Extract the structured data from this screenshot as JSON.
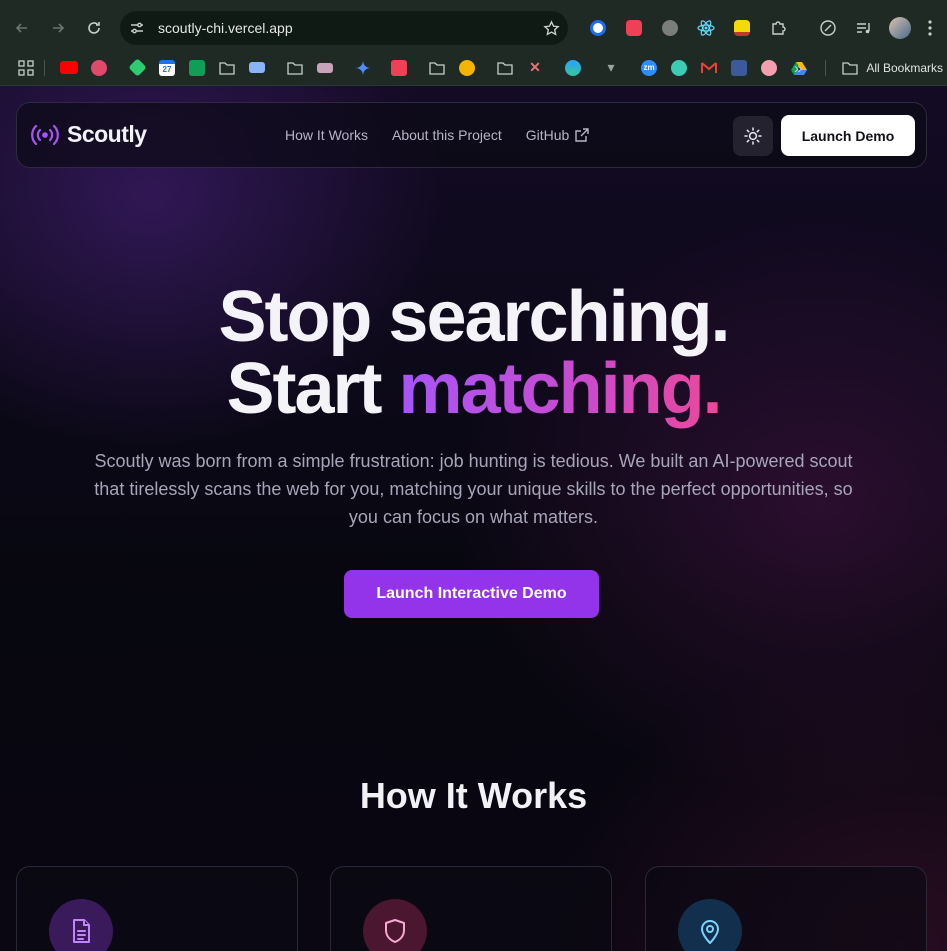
{
  "browser": {
    "url": "scoutly-chi.vercel.app",
    "all_bookmarks_label": "All Bookmarks",
    "calendar_ext_label": "27",
    "zm_ext_label": "zm"
  },
  "brand": {
    "name": "Scoutly"
  },
  "nav": {
    "links": [
      "How It Works",
      "About this Project",
      "GitHub"
    ],
    "launch_demo": "Launch Demo"
  },
  "hero": {
    "line1": "Stop searching.",
    "line2_plain": "Start",
    "line2_accent": "matching.",
    "subtitle": "Scoutly was born from a simple frustration: job hunting is tedious. We built an AI-powered scout that tirelessly scans the web for you, matching your unique skills to the perfect opportunities, so you can focus on what matters.",
    "cta": "Launch Interactive Demo"
  },
  "how_it_works": {
    "title": "How It Works",
    "cards": [
      {
        "icon": "document-icon",
        "color": "#c084fc",
        "bg": "#3b1a5c"
      },
      {
        "icon": "shield-icon",
        "color": "#f9a8d4",
        "bg": "#4a1630"
      },
      {
        "icon": "map-pin-icon",
        "color": "#7dd3fc",
        "bg": "#12304d"
      }
    ]
  },
  "colors": {
    "accent_purple": "#9333ea",
    "gradient_start": "#a855f7",
    "gradient_end": "#ec4899"
  }
}
